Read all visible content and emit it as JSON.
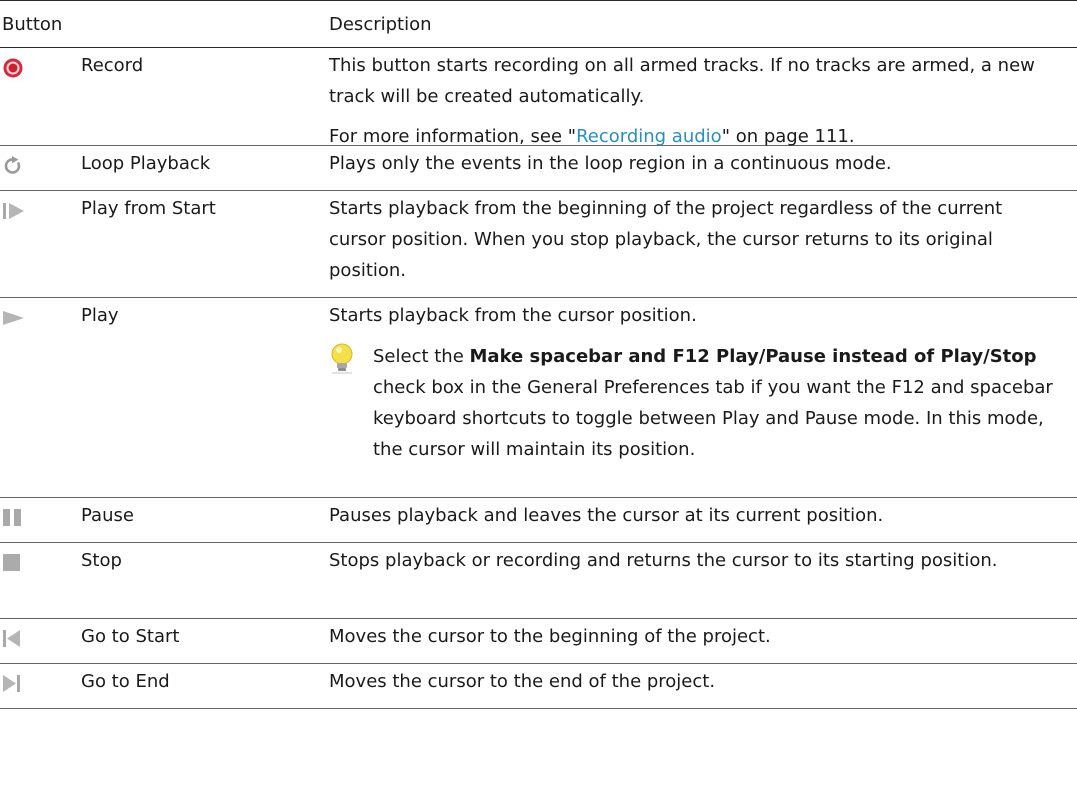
{
  "header": {
    "button": "Button",
    "description": "Description"
  },
  "rows": [
    {
      "icon": "record-icon",
      "name": "Record",
      "description": "This button starts recording on all armed tracks. If no tracks are armed, a new track will be created automatically.",
      "more_prefix": "For more information, see \"",
      "more_link": "Recording audio",
      "more_suffix": "\" on page 111."
    },
    {
      "icon": "loop-icon",
      "name": "Loop Playback",
      "description": "Plays only the events in the loop region in a continuous mode."
    },
    {
      "icon": "play-from-start-icon",
      "name": "Play from Start",
      "description": "Starts playback from the beginning of the project regardless of the current cursor position. When you stop playback, the cursor returns to its original position."
    },
    {
      "icon": "play-icon",
      "name": "Play",
      "description": "Starts playback from the cursor position.",
      "tip_prefix": "Select the ",
      "tip_bold": "Make spacebar and F12 Play/Pause instead of Play/Stop",
      "tip_suffix": " check box in the General Preferences tab if you want the F12 and spacebar keyboard shortcuts to toggle between Play and Pause mode. In this mode, the cursor will maintain its position."
    },
    {
      "icon": "pause-icon",
      "name": "Pause",
      "description": "Pauses playback and leaves the cursor at its current position."
    },
    {
      "icon": "stop-icon",
      "name": "Stop",
      "description": "Stops playback or recording and returns the cursor to its starting position."
    },
    {
      "icon": "go-to-start-icon",
      "name": "Go to Start",
      "description": "Moves the cursor to the beginning of the project."
    },
    {
      "icon": "go-to-end-icon",
      "name": "Go to End",
      "description": "Moves the cursor to the end of the project."
    }
  ],
  "colors": {
    "link": "#2a8fc0",
    "record_red": "#d62a3a",
    "icon_gray": "#a9a9a9",
    "tip_yellow": "#f5e04a"
  }
}
